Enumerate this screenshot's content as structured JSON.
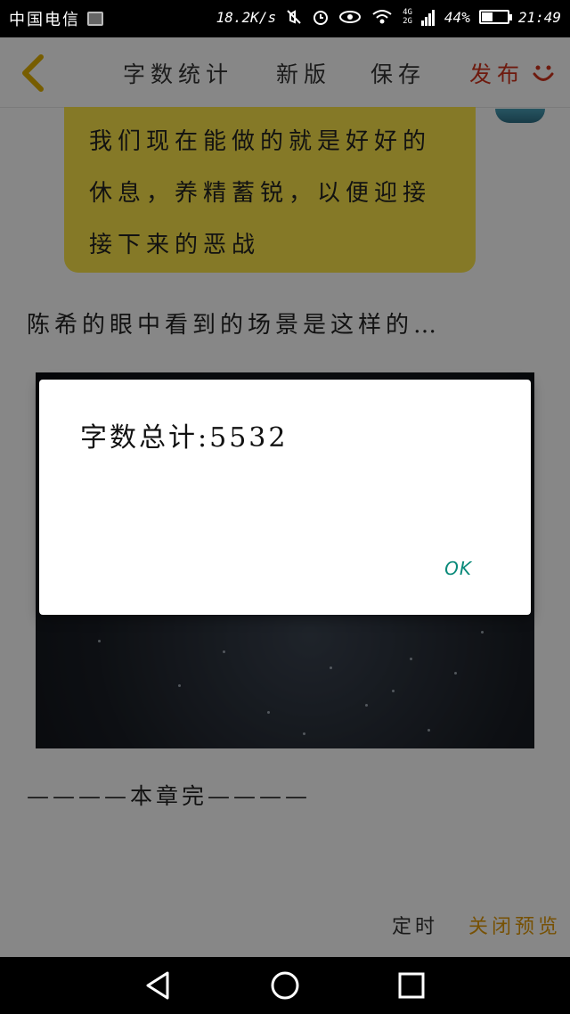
{
  "status_bar": {
    "carrier": "中国电信",
    "speed": "18.2K/s",
    "net_top": "4G",
    "net_bottom": "2G",
    "battery": "44%",
    "battery_level": 0.44,
    "time": "21:49"
  },
  "toolbar": {
    "count_label": "字数统计",
    "new_label": "新版",
    "save_label": "保存",
    "publish_label": "发布",
    "accent_color": "#d0321c"
  },
  "content": {
    "bubble_text": "我们现在能做的就是好好的休息，养精蓄锐，以便迎接接下来的恶战",
    "paragraph": "陈希的眼中看到的场景是这样的…",
    "chapter_end": "————本章完————"
  },
  "bottom_actions": {
    "timer_label": "定时",
    "close_preview_label": "关闭预览",
    "close_color": "#e09a0a"
  },
  "dialog": {
    "message": "字数总计:5532",
    "ok_label": "OK",
    "ok_color": "#0a8a7a"
  },
  "icons": {
    "back": "chevron-left-icon",
    "smile": "smile-icon",
    "nav_back": "triangle-back-icon",
    "nav_home": "circle-home-icon",
    "nav_recent": "square-recent-icon"
  }
}
